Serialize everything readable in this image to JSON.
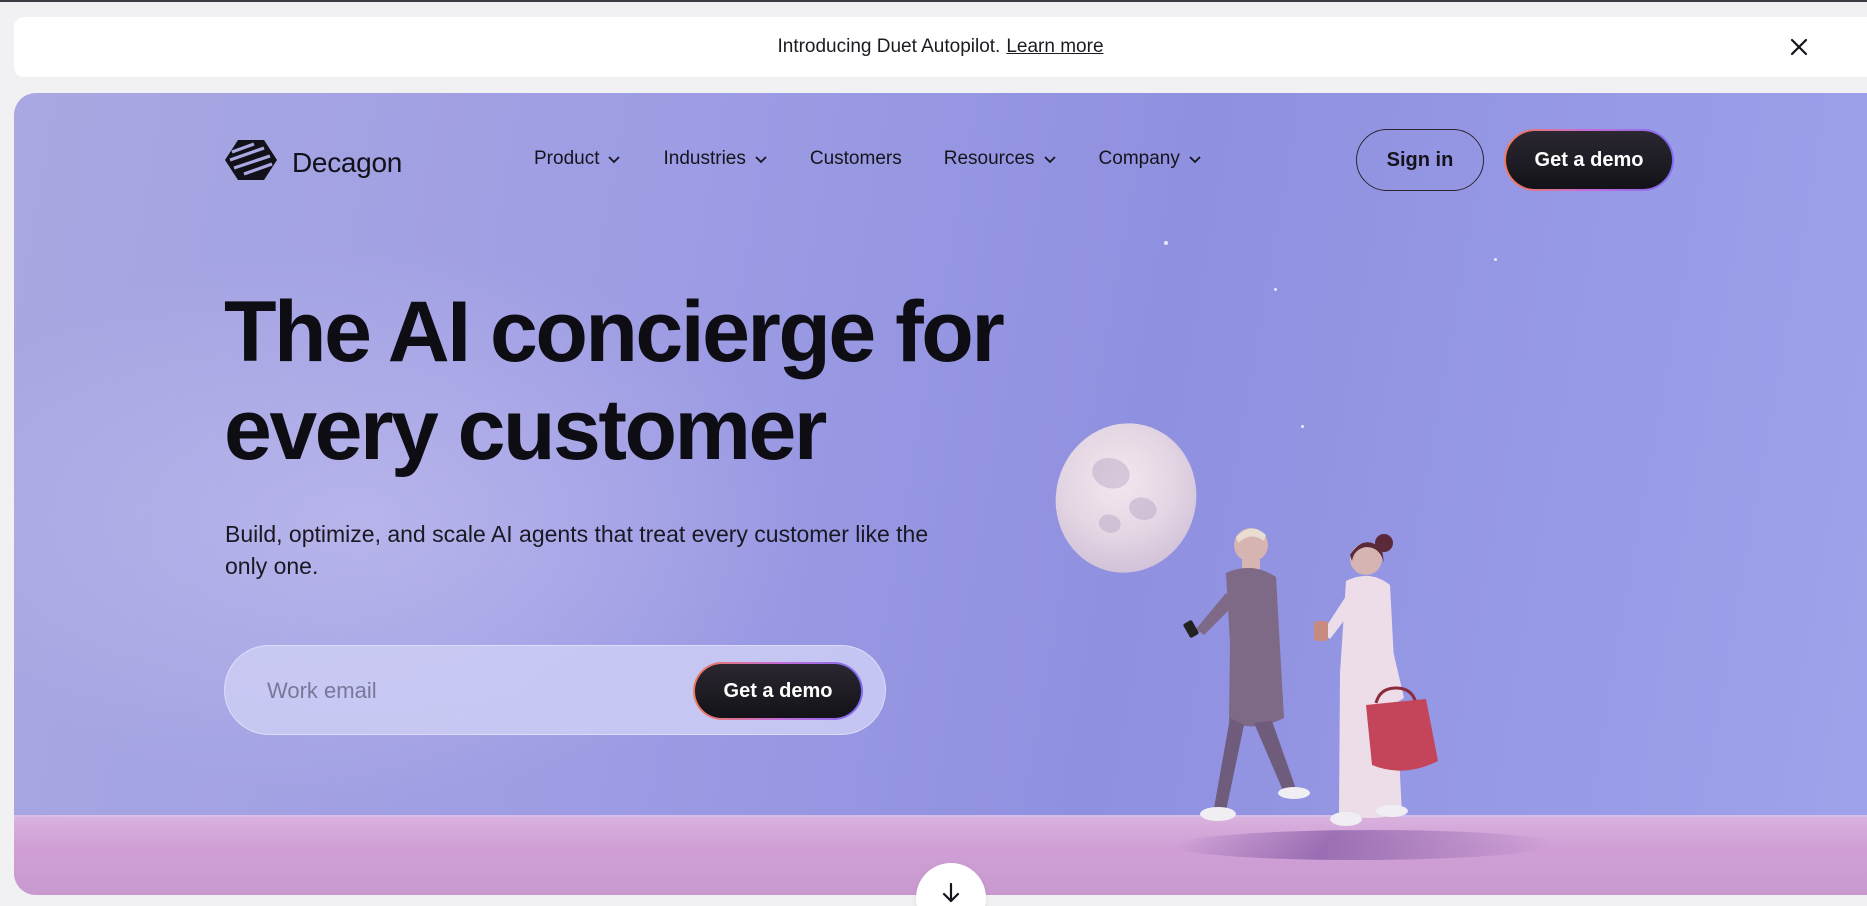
{
  "announcement": {
    "text": "Introducing Duet Autopilot.",
    "link": "Learn more",
    "close_icon": "close-icon"
  },
  "brand": {
    "name": "Decagon",
    "logo_icon": "decagon-logo-icon"
  },
  "nav": {
    "items": [
      {
        "label": "Product",
        "has_dropdown": true
      },
      {
        "label": "Industries",
        "has_dropdown": true
      },
      {
        "label": "Customers",
        "has_dropdown": false
      },
      {
        "label": "Resources",
        "has_dropdown": true
      },
      {
        "label": "Company",
        "has_dropdown": true
      }
    ],
    "sign_in": "Sign in",
    "get_demo": "Get a demo"
  },
  "hero": {
    "headline": "The AI concierge for every customer",
    "subtext": "Build, optimize, and scale AI agents that treat every customer like the only one.",
    "email_placeholder": "Work email",
    "email_value": "",
    "cta": "Get a demo"
  },
  "scroll": {
    "icon": "arrow-down-icon"
  },
  "colors": {
    "hero_bg": "#9d9ce4",
    "cta_bg": "#1c1a22",
    "cta_border_start": "#f07a5a",
    "cta_border_end": "#7d6cf2",
    "ground": "#d0a3d6"
  }
}
